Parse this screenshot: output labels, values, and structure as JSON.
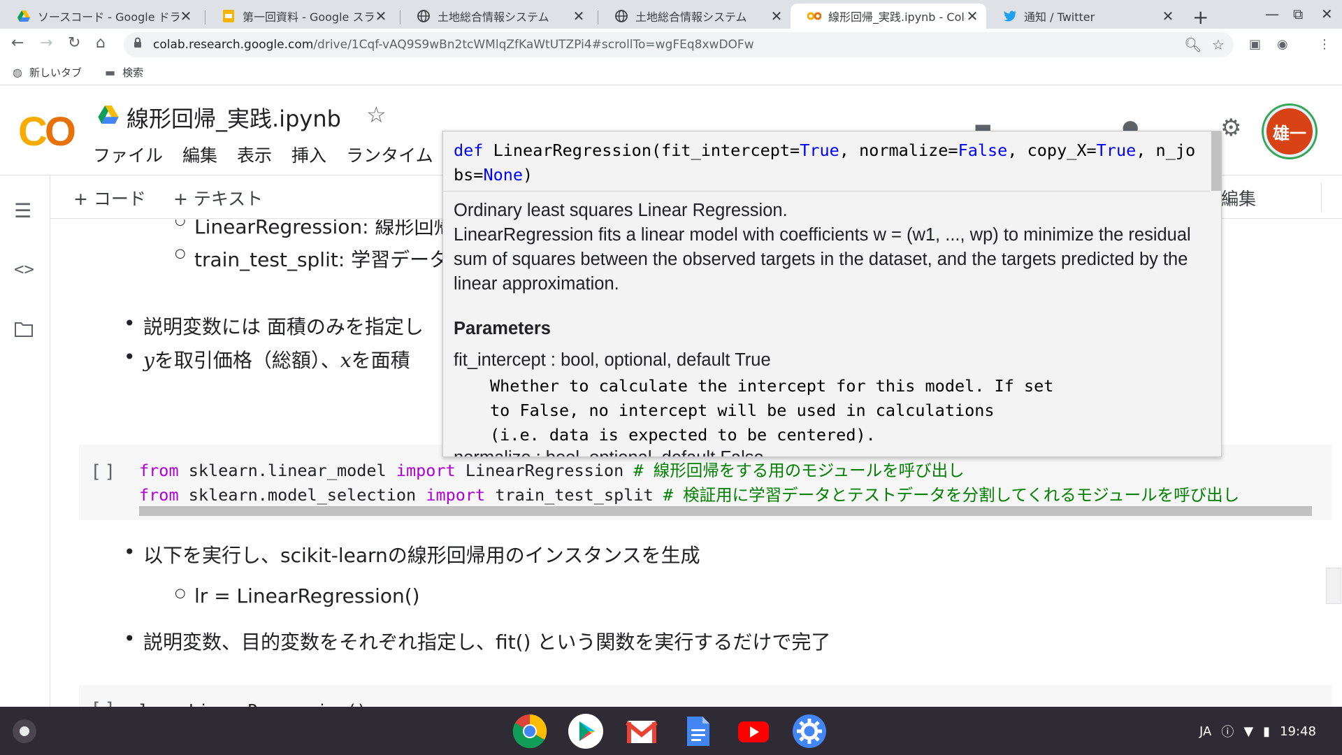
{
  "tabs": [
    {
      "title": "ソースコード - Google ドラ",
      "icon": "google-drive-icon"
    },
    {
      "title": "第一回資料 - Google スライ",
      "icon": "google-slides-icon"
    },
    {
      "title": "土地総合情報システム",
      "icon": "globe-icon"
    },
    {
      "title": "土地総合情報システム",
      "icon": "globe-icon"
    },
    {
      "title": "線形回帰_実践.ipynb - Colab",
      "icon": "colab-icon",
      "active": true
    },
    {
      "title": "通知 / Twitter",
      "icon": "twitter-icon"
    }
  ],
  "address": {
    "host": "colab.research.google.com",
    "path": "/drive/1Cqf-vAQ9S9wBn2tcWMlqZfKaWtUTZPi4#scrollTo=wgFEq8xwDOFw"
  },
  "bookmarks": [
    {
      "label": "新しいタブ",
      "icon": "globe-icon"
    },
    {
      "label": "検索",
      "icon": "folder-icon"
    }
  ],
  "colab": {
    "logo": "CO",
    "notebook_title": "線形回帰_実践.ipynb",
    "menus": [
      "ファイル",
      "編集",
      "表示",
      "挿入",
      "ランタイム"
    ],
    "avatar_text": "雄一",
    "add_code": "+ コード",
    "add_text": "+ テキスト",
    "edit_label": "編集"
  },
  "content": {
    "sub1": "LinearRegression: 線形回帰",
    "sub2": "train_test_split: 学習データ",
    "bullet1": "説明変数には 面積のみを指定し",
    "bullet2_y": "y",
    "bullet2_a": "を取引価格（総額）、",
    "bullet2_x": "x",
    "bullet2_b": "を面積",
    "code1": {
      "kw1": "from",
      "mod1": " sklearn.linear_model ",
      "kw2": "import",
      "name1": " LinearRegression ",
      "cm1": "# 線形回帰をする用のモジュールを呼び出し"
    },
    "code2": {
      "kw1": "from",
      "mod1": " sklearn.model_selection ",
      "kw2": "import",
      "name1": " train_test_split ",
      "cm1": "# 検証用に学習データとテストデータを分割してくれるモジュールを呼び出し"
    },
    "cell_run_label": "[ ]",
    "bullet3": "以下を実行し、scikit-learnの線形回帰用のインスタンスを生成",
    "sub3": "lr = LinearRegression()",
    "bullet4": "説明変数、目的変数をそれぞれ指定し、fit() という関数を実行するだけで完了",
    "next_cell_partial": "lr = LinearRegression()"
  },
  "tooltip": {
    "sig_def": "def",
    "sig_a": " LinearRegression(fit_intercept=",
    "sig_true1": "True",
    "sig_b": ", normalize=",
    "sig_false": "False",
    "sig_c": ", copy_X=",
    "sig_true2": "True",
    "sig_d": ", n_jobs=",
    "sig_none": "None",
    "sig_e": ")",
    "line1": "Ordinary least squares Linear Regression.",
    "line2": "LinearRegression fits a linear model with coefficients w = (w1, ..., wp) to minimize the residual sum of squares between the observed targets in the dataset, and the targets predicted by the linear approximation.",
    "params_heading": "Parameters",
    "param1": "fit_intercept : bool, optional, default True",
    "param1_desc": "Whether to calculate the intercept for this model. If set\nto False, no intercept will be used in calculations\n(i.e. data is expected to be centered).",
    "param2_cut": "normalize : bool, optional, default False"
  },
  "status": {
    "lang": "JA",
    "time": "19:48"
  },
  "shelf_apps": [
    "chrome-icon",
    "play-store-icon",
    "gmail-icon",
    "docs-icon",
    "youtube-icon",
    "settings-icon"
  ]
}
